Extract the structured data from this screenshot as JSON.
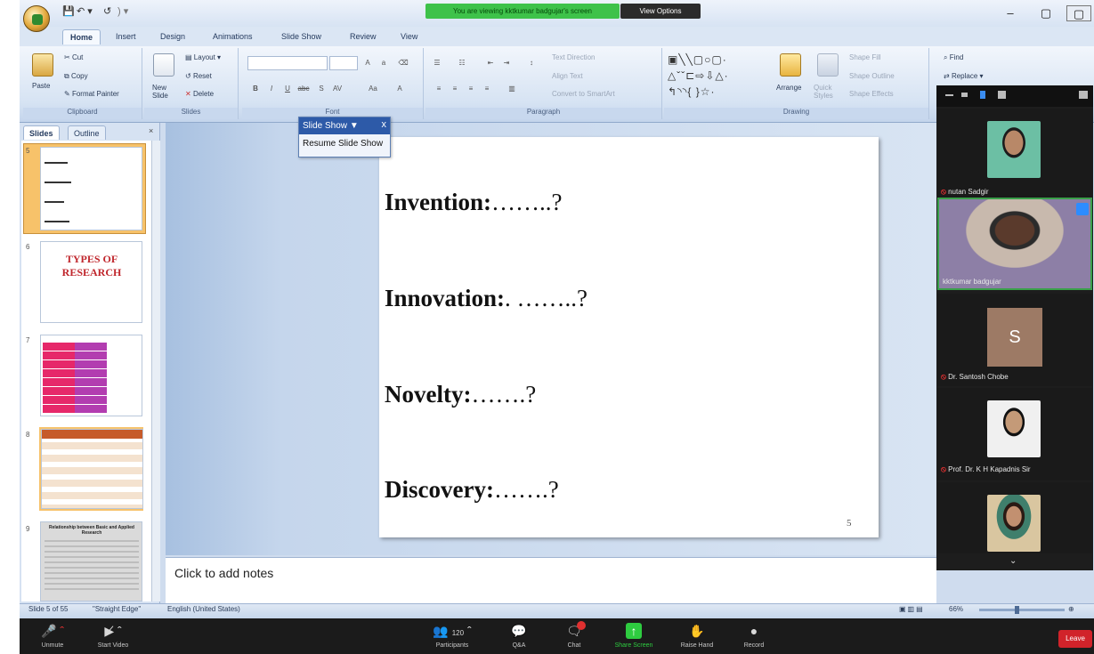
{
  "zoom_banner": {
    "viewing": "You are viewing kktkumar badgujar's screen",
    "view_options": "View Options"
  },
  "app": {
    "window_controls": [
      "–",
      "▢",
      "▢"
    ]
  },
  "ribbon": {
    "tabs": [
      "Home",
      "Insert",
      "Design",
      "Animations",
      "Slide Show",
      "Review",
      "View"
    ],
    "active_tab": "Home",
    "clipboard": {
      "paste": "Paste",
      "cut": "Cut",
      "copy": "Copy",
      "format_painter": "Format Painter",
      "label": "Clipboard"
    },
    "slides": {
      "new_slide": "New Slide",
      "layout": "Layout",
      "reset": "Reset",
      "delete": "Delete",
      "label": "Slides"
    },
    "font": {
      "label": "Font"
    },
    "paragraph": {
      "text_direction": "Text Direction",
      "align_text": "Align Text",
      "convert_smartart": "Convert to SmartArt",
      "label": "Paragraph"
    },
    "drawing": {
      "arrange": "Arrange",
      "quick_styles": "Quick Styles",
      "shape_fill": "Shape Fill",
      "shape_outline": "Shape Outline",
      "shape_effects": "Shape Effects",
      "label": "Drawing"
    },
    "editing": {
      "find": "Find",
      "replace": "Replace"
    }
  },
  "left_pane": {
    "tabs": [
      "Slides",
      "Outline"
    ],
    "slide_numbers": [
      "5",
      "6",
      "7",
      "8",
      "9"
    ],
    "thumb6_title": "TYPES OF RESEARCH",
    "thumb9_title": "Relationship between Basic and Applied Research"
  },
  "slideshow_toolbar": {
    "title": "Slide Show",
    "close": "x",
    "resume": "Resume Slide Show"
  },
  "slide": {
    "lines": [
      {
        "term": "Invention:",
        "tail": "……..?"
      },
      {
        "term": "Innovation:",
        "tail": ". ……..?"
      },
      {
        "term": "Novelty:",
        "tail": "…….?"
      },
      {
        "term": "Discovery:",
        "tail": "…….?"
      }
    ],
    "number": "5"
  },
  "notes": {
    "placeholder": "Click to add notes"
  },
  "status": {
    "slide_of": "Slide 5 of 55",
    "theme": "\"Straight Edge\"",
    "language": "English (United States)",
    "zoom": "66%"
  },
  "participants": [
    {
      "name": "nutan Sadgir",
      "kind": "video"
    },
    {
      "name": "kktkumar badgujar",
      "kind": "video"
    },
    {
      "name": "Dr. Santosh Chobe",
      "kind": "initial",
      "initial": "S"
    },
    {
      "name": "Prof. Dr. K H Kapadnis Sir",
      "kind": "video"
    },
    {
      "name": "",
      "kind": "video"
    }
  ],
  "zoom_toolbar": {
    "unmute": "Unmute",
    "start_video": "Start Video",
    "participants": "Participants",
    "participant_count": "120",
    "qa": "Q&A",
    "chat": "Chat",
    "share_screen": "Share Screen",
    "raise_hand": "Raise Hand",
    "record": "Record",
    "leave": "Leave"
  },
  "colors": {
    "share_green": "#3ec24a",
    "leave_red": "#d1232a",
    "ribbon_blue": "#d6e3f3",
    "thumb_title_red": "#c0272d"
  }
}
